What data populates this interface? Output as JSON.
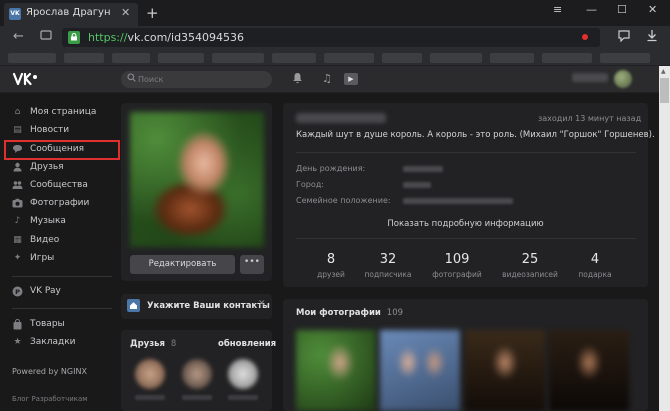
{
  "browser": {
    "tab_title": "Ярослав Драгун",
    "tab_close": "✕",
    "new_tab": "+",
    "url_scheme": "https://",
    "url_rest": "vk.com/id354094536",
    "lock": "🔒",
    "nav_back": "←",
    "menu_icon": "≡",
    "minimize": "—",
    "maximize": "☐",
    "close": "✕",
    "tab_logo": "VK"
  },
  "header": {
    "logo": "VK",
    "search_placeholder": "Поиск",
    "search_icon": "⌕",
    "bell": "🔔",
    "music": "♫",
    "play": "▶"
  },
  "sidebar": {
    "items": [
      {
        "label": "Моя страница",
        "icon": "⌂"
      },
      {
        "label": "Новости",
        "icon": "▤"
      },
      {
        "label": "Сообщения",
        "icon": "◆"
      },
      {
        "label": "Друзья",
        "icon": "♟"
      },
      {
        "label": "Сообщества",
        "icon": "♣"
      },
      {
        "label": "Фотографии",
        "icon": "◙"
      },
      {
        "label": "Музыка",
        "icon": "♪"
      },
      {
        "label": "Видео",
        "icon": "▦"
      },
      {
        "label": "Игры",
        "icon": "✦"
      }
    ],
    "vkpay": {
      "label": "VK Pay",
      "icon": "P"
    },
    "extra": [
      {
        "label": "Товары",
        "icon": "▣"
      },
      {
        "label": "Закладки",
        "icon": "★"
      }
    ],
    "powered": "Powered by NGINX",
    "footer": "Блог   Разработчикам"
  },
  "profile": {
    "edit_label": "Редактировать",
    "more_label": "•••",
    "contacts_text": "Укажите Ваши контакты",
    "contacts_close": "✕",
    "friends_label": "Друзья",
    "friends_count": "8",
    "updates_label": "обновления"
  },
  "info": {
    "online": "заходил 13 минут назад",
    "status": "Каждый шут в душе король. А король - это роль. (Михаил \"Горшок\" Горшенев).",
    "birthday_label": "День рождения:",
    "city_label": "Город:",
    "family_label": "Семейное положение:",
    "show_more": "Показать подробную информацию",
    "stats": [
      {
        "num": "8",
        "label": "друзей"
      },
      {
        "num": "32",
        "label": "подписчика"
      },
      {
        "num": "109",
        "label": "фотографий"
      },
      {
        "num": "25",
        "label": "видеозаписей"
      },
      {
        "num": "4",
        "label": "подарка"
      }
    ]
  },
  "photos": {
    "title": "Мои фотографии",
    "count": "109"
  },
  "colors": {
    "accent_red": "#e0302e",
    "vk_blue": "#4a76a8",
    "lock_green": "#3b9c47"
  }
}
